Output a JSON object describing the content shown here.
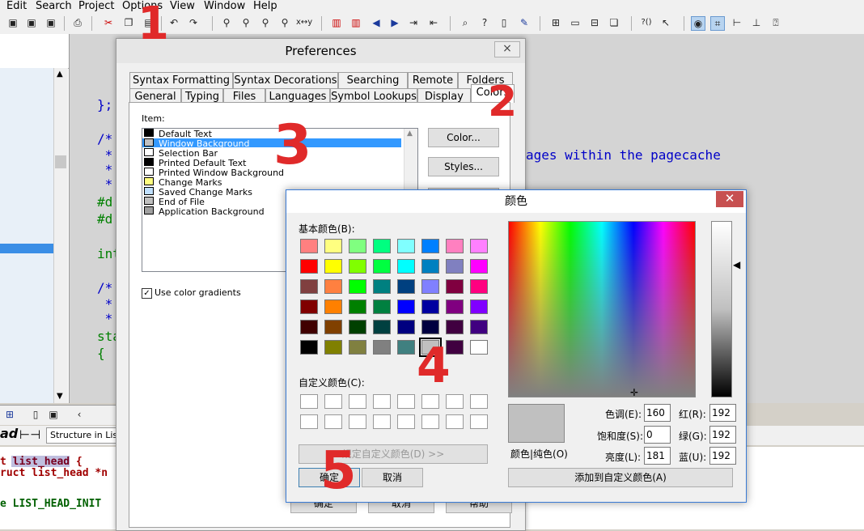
{
  "menu": [
    "Edit",
    "Search",
    "Project",
    "Options",
    "View",
    "Window",
    "Help"
  ],
  "toolbar_icons": [
    "save-icon",
    "save-all-icon",
    "save-icon",
    "print-icon",
    "cut-icon",
    "copy-icon",
    "paste-icon",
    "undo-icon",
    "redo-icon",
    "binoculars-icon",
    "find-prev-icon",
    "find-next-icon",
    "replace-icon",
    "xy-icon",
    "bookmark-icon",
    "bookmark-icon",
    "arrow-left-icon",
    "arrow-right-icon",
    "indent-icon",
    "outdent-icon",
    "lookup-icon",
    "help-icon",
    "book-icon",
    "signature-icon",
    "window-icon",
    "window-icon",
    "window-icon",
    "window-icon",
    "symbol-icon",
    "pointer-icon",
    "relation-icon",
    "browse-icon",
    "tree-icon",
    "layout-icon",
    "help-box-icon"
  ],
  "editor": {
    "lines": [
      "};",
      "/*",
      " *",
      " *",
      " *",
      "#d",
      "#d",
      "int",
      "/*",
      " *",
      " *",
      "sta",
      "{"
    ],
    "fragment": "ages within the pagecache"
  },
  "bottom": {
    "header_word": "ad",
    "title": "Structure in List.h",
    "code": [
      "t list_head {",
      "ruct list_head *n",
      "e LIST_HEAD_INIT"
    ]
  },
  "preferences": {
    "title": "Preferences",
    "close": "×",
    "tabs_row1": [
      "Syntax Formatting",
      "Syntax Decorations",
      "Searching",
      "Remote",
      "Folders"
    ],
    "tabs_row2": [
      "General",
      "Typing",
      "Files",
      "Languages",
      "Symbol Lookups",
      "Display",
      "Colors"
    ],
    "item_label": "Item:",
    "items": [
      {
        "label": "Default Text",
        "color": "#000000"
      },
      {
        "label": "Window Background",
        "color": "#c0c0c0"
      },
      {
        "label": "Selection Bar",
        "color": "#ffffff"
      },
      {
        "label": "Printed Default Text",
        "color": "#000000"
      },
      {
        "label": "Printed Window Background",
        "color": "#ffffff"
      },
      {
        "label": "Change Marks",
        "color": "#ffff80"
      },
      {
        "label": "Saved Change Marks",
        "color": "#c0e0ff"
      },
      {
        "label": "End of File",
        "color": "#c0c0c0"
      },
      {
        "label": "Application Background",
        "color": "#a0a0a0"
      }
    ],
    "selected_item": "Window Background",
    "color_button": "Color...",
    "styles_button": "Styles...",
    "gradients_label": "Use color gradients",
    "bottom_buttons": [
      "确定",
      "取消",
      "帮助"
    ]
  },
  "color_dialog": {
    "title": "颜色",
    "close": "✕",
    "basic_label": "基本颜色(B):",
    "basic_colors": [
      "#ff8080",
      "#ffff80",
      "#80ff80",
      "#00ff80",
      "#80ffff",
      "#0080ff",
      "#ff80c0",
      "#ff80ff",
      "#ff0000",
      "#ffff00",
      "#80ff00",
      "#00ff40",
      "#00ffff",
      "#0080c0",
      "#8080c0",
      "#ff00ff",
      "#804040",
      "#ff8040",
      "#00ff00",
      "#008080",
      "#004080",
      "#8080ff",
      "#800040",
      "#ff0080",
      "#800000",
      "#ff8000",
      "#008000",
      "#008040",
      "#0000ff",
      "#0000a0",
      "#800080",
      "#8000ff",
      "#400000",
      "#804000",
      "#004000",
      "#004040",
      "#000080",
      "#000040",
      "#400040",
      "#400080",
      "#000000",
      "#808000",
      "#808040",
      "#808080",
      "#408080",
      "#c0c0c0",
      "#400040",
      "#ffffff"
    ],
    "selected_index": 45,
    "custom_label": "自定义颜色(C):",
    "define_button": "规定自定义颜色(D) >>",
    "ok_button": "确定",
    "cancel_button": "取消",
    "preview_label": "颜色|纯色(O)",
    "hue_label": "色调(E):",
    "hue": "160",
    "sat_label": "饱和度(S):",
    "sat": "0",
    "lum_label": "亮度(L):",
    "lum": "181",
    "red_label": "红(R):",
    "red": "192",
    "green_label": "绿(G):",
    "green": "192",
    "blue_label": "蓝(U):",
    "blue": "192",
    "add_custom_button": "添加到自定义颜色(A)",
    "preview_color": "#c0c0c0"
  },
  "annotations": [
    "1",
    "2",
    "3",
    "4",
    "5"
  ]
}
